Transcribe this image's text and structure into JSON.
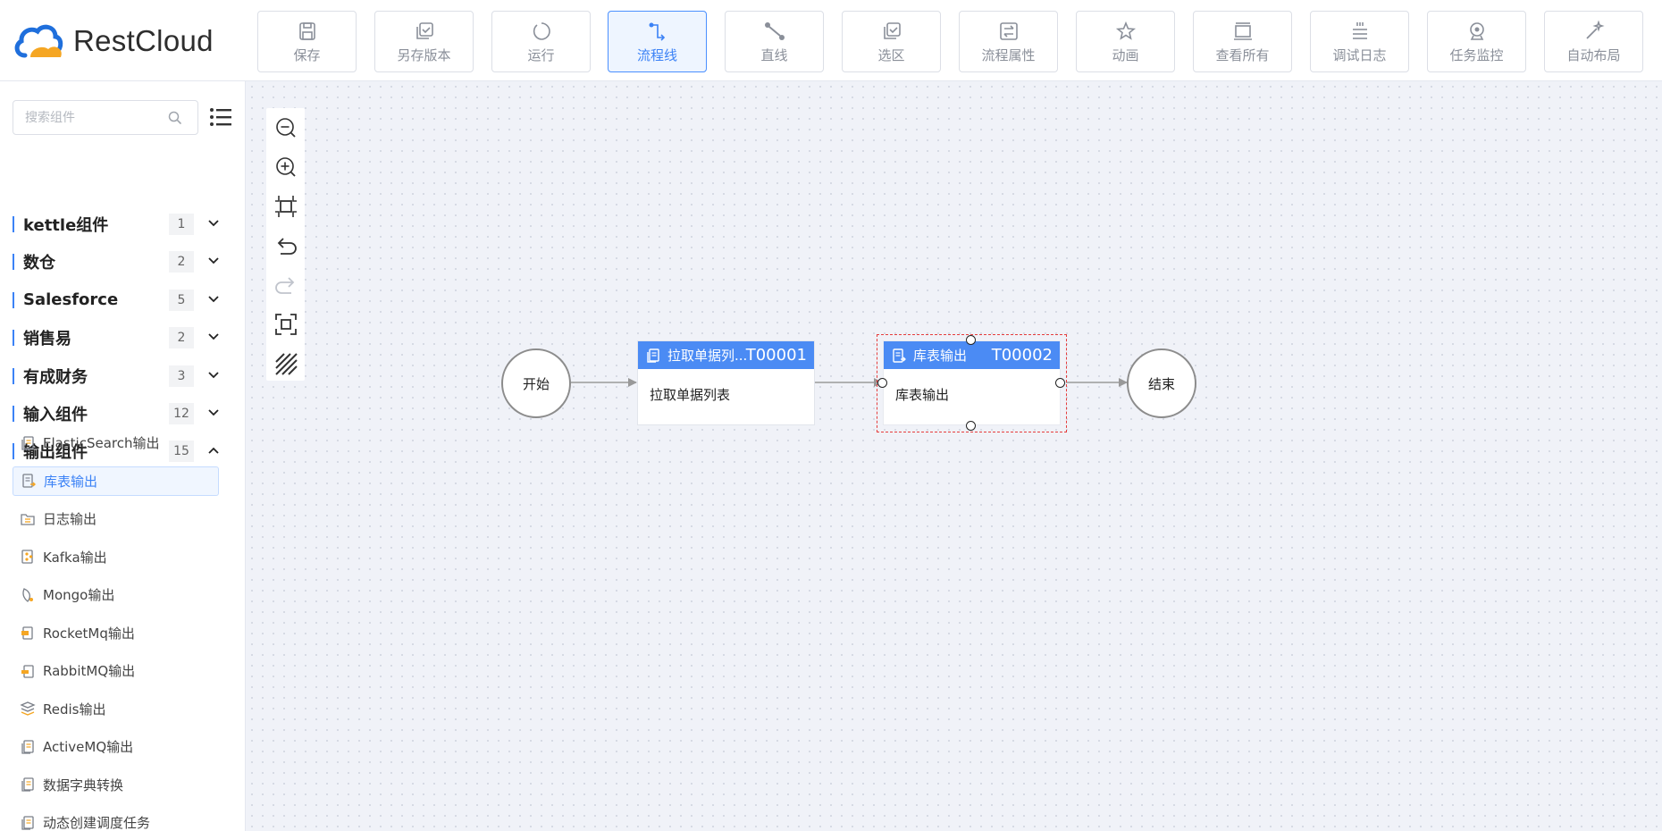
{
  "app": {
    "name": "RestCloud"
  },
  "toolbar": [
    {
      "key": "save",
      "label": "保存",
      "icon": "save-icon",
      "active": false
    },
    {
      "key": "save-version",
      "label": "另存版本",
      "icon": "save-version-icon",
      "active": false
    },
    {
      "key": "run",
      "label": "运行",
      "icon": "run-icon",
      "active": false
    },
    {
      "key": "flow-line",
      "label": "流程线",
      "icon": "flow-line-icon",
      "active": true
    },
    {
      "key": "straight-line",
      "label": "直线",
      "icon": "straight-line-icon",
      "active": false
    },
    {
      "key": "select-area",
      "label": "选区",
      "icon": "select-area-icon",
      "active": false
    },
    {
      "key": "flow-props",
      "label": "流程属性",
      "icon": "flow-properties-icon",
      "active": false
    },
    {
      "key": "animation",
      "label": "动画",
      "icon": "animation-icon",
      "active": false
    },
    {
      "key": "view-all",
      "label": "查看所有",
      "icon": "view-all-icon",
      "active": false
    },
    {
      "key": "debug-log",
      "label": "调试日志",
      "icon": "debug-log-icon",
      "active": false
    },
    {
      "key": "task-monitor",
      "label": "任务监控",
      "icon": "task-monitor-icon",
      "active": false
    },
    {
      "key": "auto-layout",
      "label": "自动布局",
      "icon": "auto-layout-icon",
      "active": false
    }
  ],
  "sidebar": {
    "search": {
      "placeholder": "搜索组件",
      "value": ""
    },
    "categories": [
      {
        "name": "kettle组件",
        "count": "1",
        "expanded": false
      },
      {
        "name": "数仓",
        "count": "2",
        "expanded": false
      },
      {
        "name": "Salesforce",
        "count": "5",
        "expanded": false
      },
      {
        "name": "销售易",
        "count": "2",
        "expanded": false
      },
      {
        "name": "有成财务",
        "count": "3",
        "expanded": false
      },
      {
        "name": "输入组件",
        "count": "12",
        "expanded": false
      },
      {
        "name": "输出组件",
        "count": "15",
        "expanded": true
      }
    ],
    "output_items": [
      {
        "label": "ElasticSearch输出",
        "icon": "document-icon",
        "selected": false
      },
      {
        "label": "库表输出",
        "icon": "table-output-icon",
        "selected": true
      },
      {
        "label": "日志输出",
        "icon": "log-file-icon",
        "selected": false
      },
      {
        "label": "Kafka输出",
        "icon": "kafka-icon",
        "selected": false
      },
      {
        "label": "Mongo输出",
        "icon": "mongo-leaf-icon",
        "selected": false
      },
      {
        "label": "RocketMq输出",
        "icon": "rocketmq-icon",
        "selected": false
      },
      {
        "label": "RabbitMQ输出",
        "icon": "rabbitmq-icon",
        "selected": false
      },
      {
        "label": "Redis输出",
        "icon": "redis-stack-icon",
        "selected": false
      },
      {
        "label": "ActiveMQ输出",
        "icon": "document-icon",
        "selected": false
      },
      {
        "label": "数据字典转换",
        "icon": "document-icon",
        "selected": false
      },
      {
        "label": "动态创建调度任务",
        "icon": "document-icon",
        "selected": false
      }
    ]
  },
  "flow": {
    "start_label": "开始",
    "end_label": "结束",
    "nodes": [
      {
        "title": "拉取单据列...",
        "code": "T00001",
        "body": "拉取单据列表"
      },
      {
        "title": "库表输出",
        "code": "T00002",
        "body": "库表输出"
      }
    ]
  },
  "colors": {
    "accent": "#4b8bf4",
    "selection": "#e53c3c",
    "edge": "#999999"
  }
}
